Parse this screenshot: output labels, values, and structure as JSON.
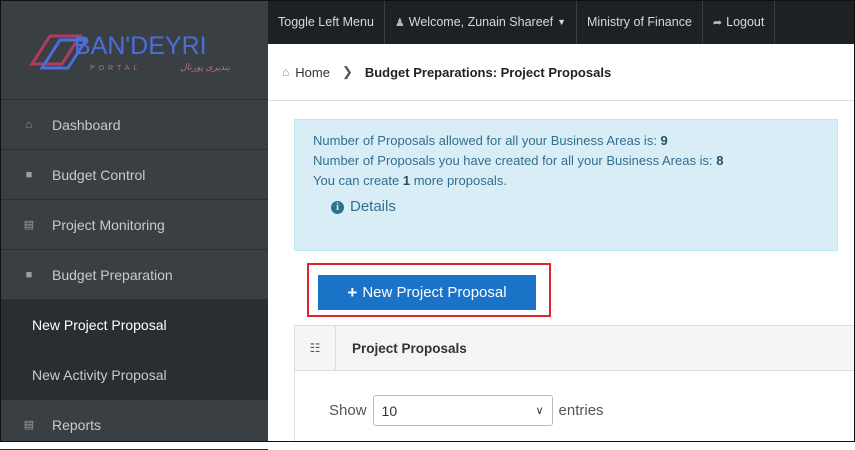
{
  "logo": {
    "brand": "BAN'DEYRI",
    "sub": "PORTAL",
    "signature": "بندیری پورتال"
  },
  "sidebar": {
    "items": [
      {
        "label": "Dashboard",
        "icon": "home-icon"
      },
      {
        "label": "Budget Control",
        "icon": "briefcase-icon"
      },
      {
        "label": "Project Monitoring",
        "icon": "table-icon"
      },
      {
        "label": "Budget Preparation",
        "icon": "briefcase-icon"
      }
    ],
    "subitems": [
      {
        "label": "New Project Proposal",
        "active": true
      },
      {
        "label": "New Activity Proposal",
        "active": false
      }
    ],
    "reports": {
      "label": "Reports",
      "icon": "table-icon"
    }
  },
  "topbar": {
    "toggle": "Toggle Left Menu",
    "welcome": "Welcome, Zunain Shareef",
    "ministry": "Ministry of Finance",
    "logout": "Logout"
  },
  "breadcrumb": {
    "home": "Home",
    "current": "Budget Preparations: Project Proposals"
  },
  "info": {
    "line1_text": "Number of Proposals allowed for all your Business Areas is: ",
    "line1_value": "9",
    "line2_text": "Number of Proposals you have created for all your Business Areas is: ",
    "line2_value": "8",
    "line3_pre": "You can create ",
    "line3_value": "1",
    "line3_post": " more proposals.",
    "details": "Details"
  },
  "new_button": {
    "label": "New Project Proposal"
  },
  "panel": {
    "title": "Project Proposals"
  },
  "entries": {
    "show": "Show",
    "value": "10",
    "suffix": "entries"
  },
  "colors": {
    "sidebar_bg": "#3a3f44",
    "topbar_bg": "#1d2124",
    "info_bg": "#d9edf7",
    "button_blue": "#1a73c7",
    "highlight_red": "#e0222d"
  }
}
